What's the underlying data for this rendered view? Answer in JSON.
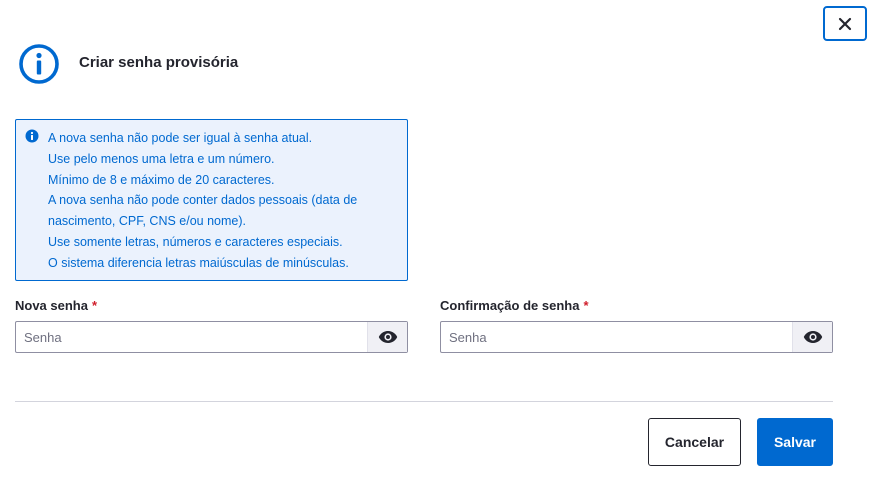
{
  "dialog": {
    "title": "Criar senha provisória",
    "close_icon": "close-icon",
    "header_icon": "info-circle-icon"
  },
  "info_box": {
    "icon": "info-icon",
    "lines": [
      "A nova senha não pode ser igual à senha atual.",
      "Use pelo menos uma letra e um número.",
      "Mínimo de 8 e máximo de 20 caracteres.",
      "A nova senha não pode conter dados pessoais (data de",
      "nascimento, CPF, CNS e/ou nome).",
      "Use somente letras, números e caracteres especiais.",
      "O sistema diferencia letras maiúsculas de minúsculas."
    ]
  },
  "fields": {
    "new_password": {
      "label": "Nova senha",
      "required_mark": "*",
      "placeholder": "Senha",
      "value": "",
      "toggle_icon": "eye-icon"
    },
    "confirm_password": {
      "label": "Confirmação de senha",
      "required_mark": "*",
      "placeholder": "Senha",
      "value": "",
      "toggle_icon": "eye-icon"
    }
  },
  "footer": {
    "cancel_label": "Cancelar",
    "save_label": "Salvar"
  },
  "colors": {
    "primary": "#0069d0",
    "info_background": "#ebf2fd",
    "required": "#d01e2b",
    "text": "#24252e"
  }
}
